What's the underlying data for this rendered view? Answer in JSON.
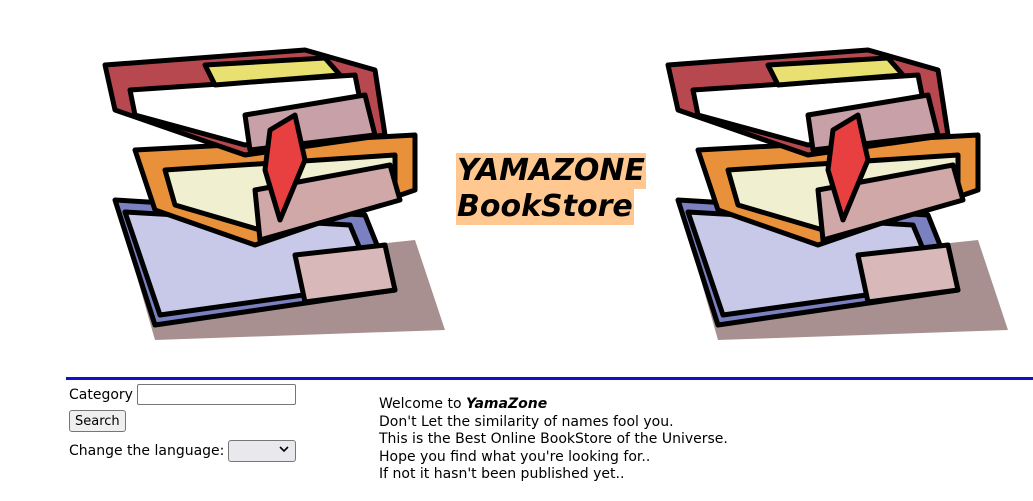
{
  "header": {
    "title_line1": "YAMAZONE",
    "title_line2": "BookStore",
    "title_bg": "#ffc890"
  },
  "divider": {
    "color": "#1010c8"
  },
  "search": {
    "category_label": "Category",
    "category_value": "",
    "search_button": "Search",
    "language_label": "Change the language:",
    "language_selected": ""
  },
  "welcome": {
    "intro": "Welcome to ",
    "brand": "YamaZone",
    "line2": "Don't Let the similarity of names fool you.",
    "line3": "This is the Best Online BookStore of the Universe.",
    "line4": "Hope you find what you're looking for..",
    "line5": "If not it hasn't been published yet.."
  },
  "icons": {
    "book_stack": "book-stack-icon"
  }
}
